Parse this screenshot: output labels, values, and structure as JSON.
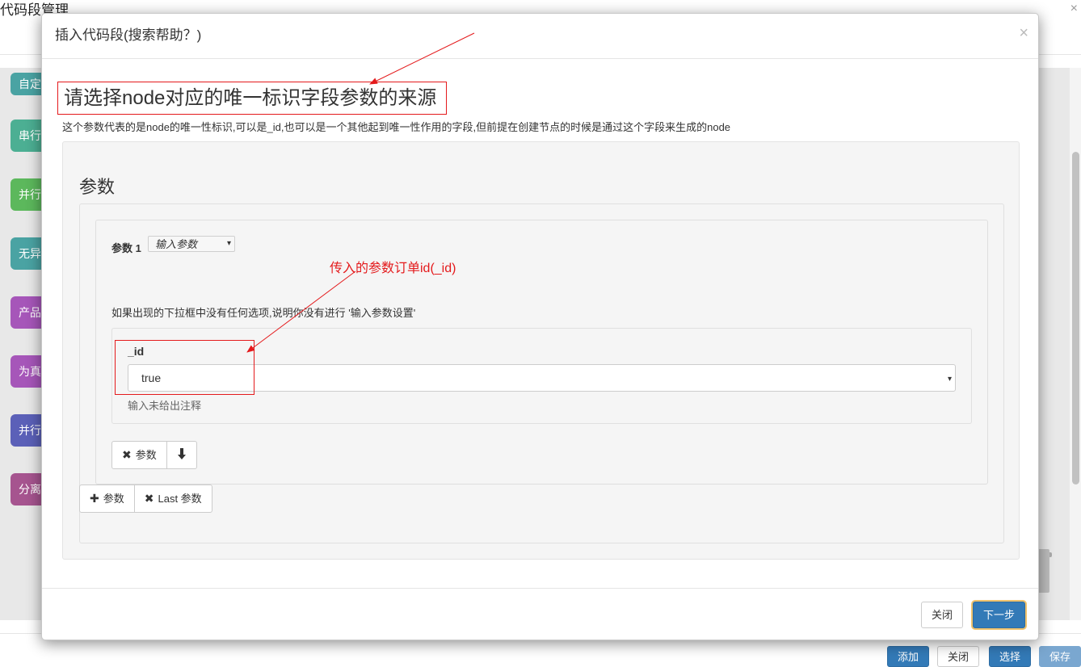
{
  "background": {
    "page_title": "代码段管理",
    "close_symbol": "×",
    "blocks": [
      {
        "label": "自定义",
        "color": "#4aa3a3"
      },
      {
        "label": "串行",
        "color": "#4caf93"
      },
      {
        "label": "并行",
        "color": "#5cb85c"
      },
      {
        "label": "无异",
        "color": "#4aa3a3"
      },
      {
        "label": "产品",
        "color": "#a656b9"
      },
      {
        "label": "为真",
        "color": "#a656b9"
      },
      {
        "label": "并行",
        "color": "#5b60b8"
      },
      {
        "label": "分离",
        "color": "#a6548f"
      }
    ],
    "footer_buttons": [
      "添加",
      "关闭",
      "选择",
      "保存"
    ]
  },
  "modal": {
    "title": "插入代码段(搜索帮助？)",
    "close_symbol": "×",
    "heading": "请选择node对应的唯一标识字段参数的来源",
    "help_text": "这个参数代表的是node的唯一性标识,可以是_id,也可以是一个其他起到唯一性作用的字段,但前提在创建节点的时候是通过这个字段来生成的node",
    "section_title": "参数",
    "param": {
      "label": "参数 1",
      "source_select": "输入参数",
      "annotation": "传入的参数订单id(_id)",
      "note": "如果出现的下拉框中没有任何选项,说明你没有进行 '输入参数设置'",
      "field": {
        "name": "_id",
        "value": "true",
        "hint": "输入未给出注释"
      },
      "remove_button": "参数",
      "remove_icon": "✖",
      "move_down_icon": "🡇"
    },
    "add_button": "参数",
    "add_icon": "✚",
    "remove_last_button": "Last 参数",
    "remove_last_icon": "✖",
    "footer": {
      "close": "关闭",
      "next": "下一步"
    },
    "accent_color": "#e41a1c"
  }
}
